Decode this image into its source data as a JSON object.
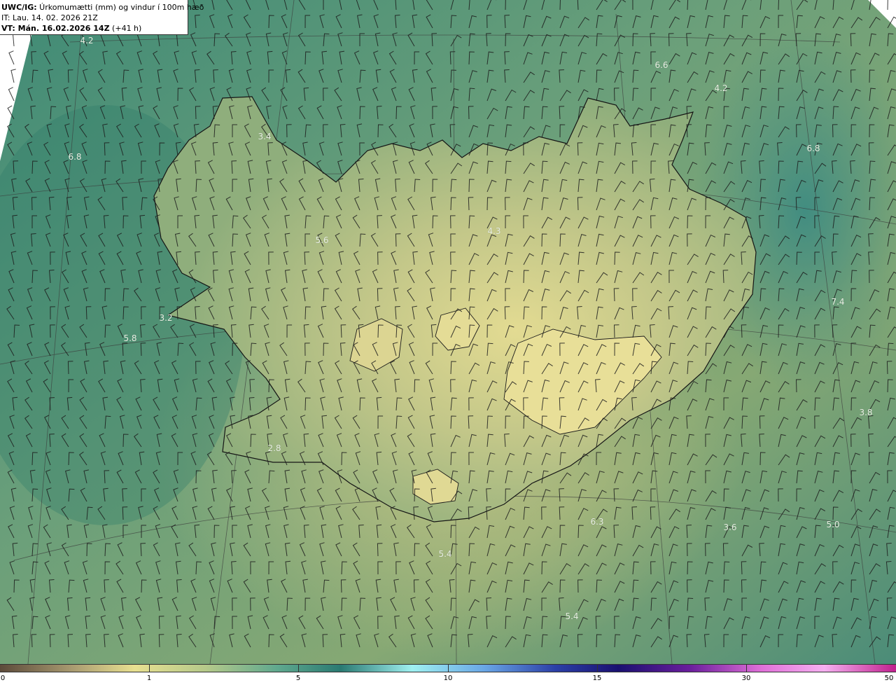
{
  "header": {
    "model_prefix": "UWC/IG:",
    "parameter": " Úrkomumætti (mm) og vindur í 100m hæð",
    "initial_time": "IT: Lau. 14. 02. 2026 21Z",
    "valid_prefix": "VT: Mán. 16.02.2026 14Z",
    "valid_suffix": " (+41 h)"
  },
  "value_labels": [
    "4.2",
    "6.6",
    "4.2",
    "3.4",
    "6.8",
    "6.8",
    "5.6",
    "4.3",
    "7.4",
    "3.2",
    "5.8",
    "3.8",
    "2.8",
    "6.3",
    "3.6",
    "5.0",
    "5.4",
    "5.4"
  ],
  "colorbar": {
    "ticks": [
      "0",
      "1",
      "5",
      "10",
      "15",
      "30",
      "50"
    ],
    "colors": [
      "#5c4a3a",
      "#a89a70",
      "#e8e090",
      "#b5c98a",
      "#5fa88e",
      "#2a7a72",
      "#9ff0f0",
      "#6aa7e6",
      "#2b3fa6",
      "#1a1070",
      "#6a1e9c",
      "#e070d8",
      "#f5b0f0",
      "#c0208e"
    ]
  },
  "map_colors": {
    "sea_dark": "#2f7a6a",
    "sea_mid": "#5b9a78",
    "land_light": "#d8d48c",
    "land_mid": "#a9b97e",
    "coast": "#1a1a1a",
    "label": "#e8efe3"
  }
}
